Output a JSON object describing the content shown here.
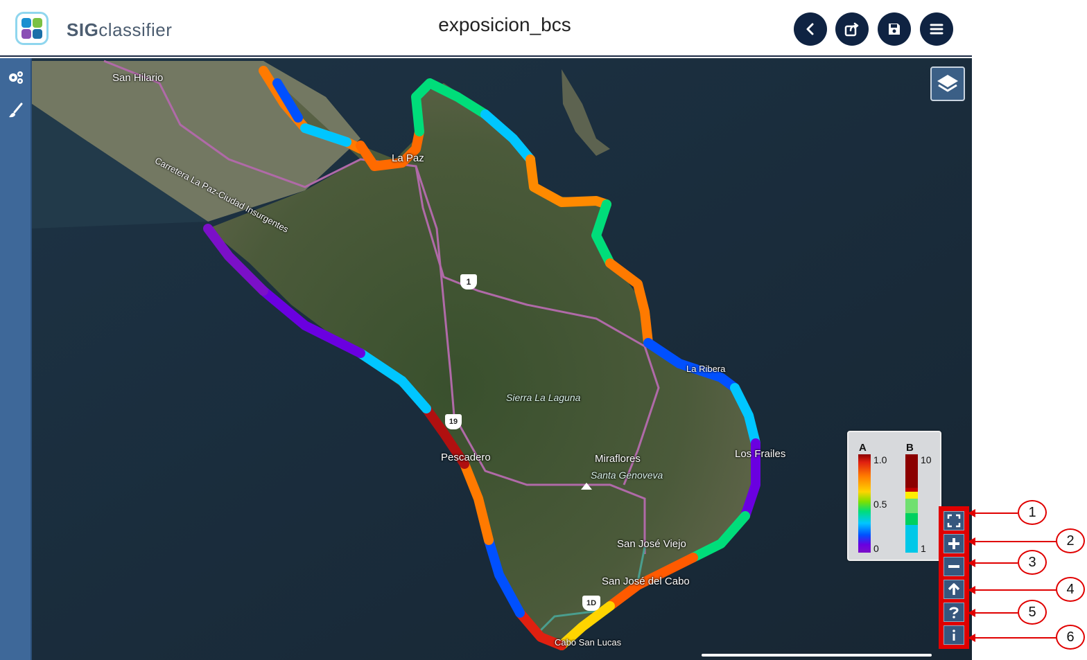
{
  "header": {
    "brand_bold": "SIG",
    "brand_rest": "classifier",
    "title": "exposicion_bcs",
    "buttons": [
      {
        "name": "back-button",
        "icon": "chevron-left-icon"
      },
      {
        "name": "share-button",
        "icon": "share-icon"
      },
      {
        "name": "save-button",
        "icon": "save-icon"
      },
      {
        "name": "menu-button",
        "icon": "hamburger-menu-icon"
      }
    ]
  },
  "left_toolbar": [
    {
      "name": "settings-button",
      "icon": "gears-icon"
    },
    {
      "name": "style-button",
      "icon": "paintbrush-icon"
    }
  ],
  "map": {
    "places": {
      "san_hilario": "San Hilario",
      "highway": "Carretera La Paz-Ciudad Insurgentes",
      "la_paz": "La Paz",
      "sierra": "Sierra La Laguna",
      "pescadero": "Pescadero",
      "miraflores": "Miraflores",
      "santa_genoveva": "Santa Genoveva",
      "los_frailes": "Los Frailes",
      "san_jose_viejo": "San José Viejo",
      "san_jose_cabo": "San José del Cabo",
      "la_ribera": "La Ribera",
      "cabo": "Cabo San Lucas",
      "shield_1": "1",
      "shield_19": "19",
      "shield_1d": "1D"
    }
  },
  "legend": {
    "a_label": "A",
    "b_label": "B",
    "a_ticks": [
      "1.0",
      "0.5",
      "0"
    ],
    "b_ticks": [
      "10",
      "1"
    ],
    "b_colors": [
      "#8b0000",
      "#c00000",
      "#ffee00",
      "#70e070",
      "#00d060",
      "#00c8e8",
      "#22b8f0"
    ]
  },
  "nav_controls": [
    {
      "name": "fullscreen-button",
      "icon": "fullscreen-icon",
      "callout": "1"
    },
    {
      "name": "zoom-in-button",
      "icon": "plus-icon",
      "callout": "2"
    },
    {
      "name": "zoom-out-button",
      "icon": "minus-icon",
      "callout": "3"
    },
    {
      "name": "north-button",
      "icon": "arrow-up-icon",
      "callout": "4"
    },
    {
      "name": "help-button",
      "icon": "question-icon",
      "callout": "5"
    },
    {
      "name": "info-button",
      "icon": "info-icon",
      "callout": "6"
    }
  ],
  "colors": {
    "header_dark": "#0f2342",
    "toolbar_blue": "#3e6899",
    "callout_red": "#e00000"
  }
}
